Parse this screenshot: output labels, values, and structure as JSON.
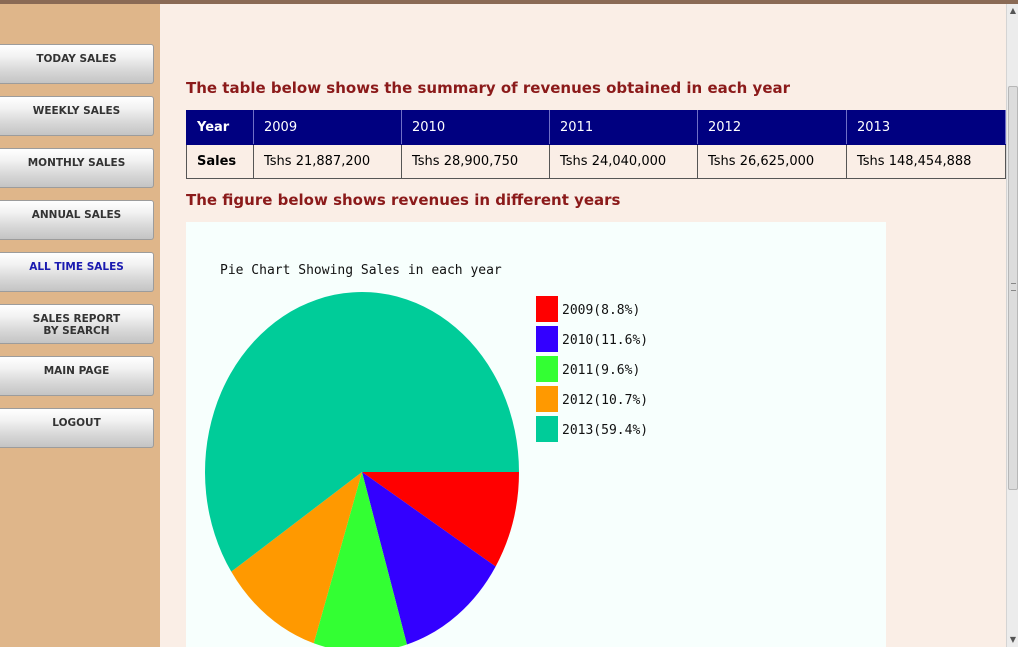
{
  "sidebar": {
    "items": [
      {
        "label": "TODAY SALES"
      },
      {
        "label": "WEEKLY SALES"
      },
      {
        "label": "MONTHLY SALES"
      },
      {
        "label": "ANNUAL SALES"
      },
      {
        "label": "ALL TIME SALES",
        "active": true
      },
      {
        "label": "SALES REPORT",
        "label2": "BY SEARCH"
      },
      {
        "label": "MAIN PAGE"
      },
      {
        "label": "LOGOUT"
      }
    ]
  },
  "main": {
    "table_heading": "The table below shows the summary of revenues obtained in each year",
    "table": {
      "header": [
        "Year",
        "2009",
        "2010",
        "2011",
        "2012",
        "2013"
      ],
      "row": [
        "Sales",
        "Tshs 21,887,200",
        "Tshs 28,900,750",
        "Tshs 24,040,000",
        "Tshs 26,625,000",
        "Tshs 148,454,888"
      ]
    },
    "figure_heading": "The figure below shows revenues in different years"
  },
  "chart_data": {
    "type": "pie",
    "title": "Pie Chart Showing Sales in each year",
    "legend_position": "right",
    "slices": [
      {
        "label": "2009(8.8%)",
        "value": 8.8,
        "color": "#ff0000"
      },
      {
        "label": "2010(11.6%)",
        "value": 11.6,
        "color": "#3300ff"
      },
      {
        "label": "2011(9.6%)",
        "value": 9.6,
        "color": "#33ff33"
      },
      {
        "label": "2012(10.7%)",
        "value": 10.7,
        "color": "#ff9900"
      },
      {
        "label": "2013(59.4%)",
        "value": 59.4,
        "color": "#00cc99"
      }
    ]
  }
}
